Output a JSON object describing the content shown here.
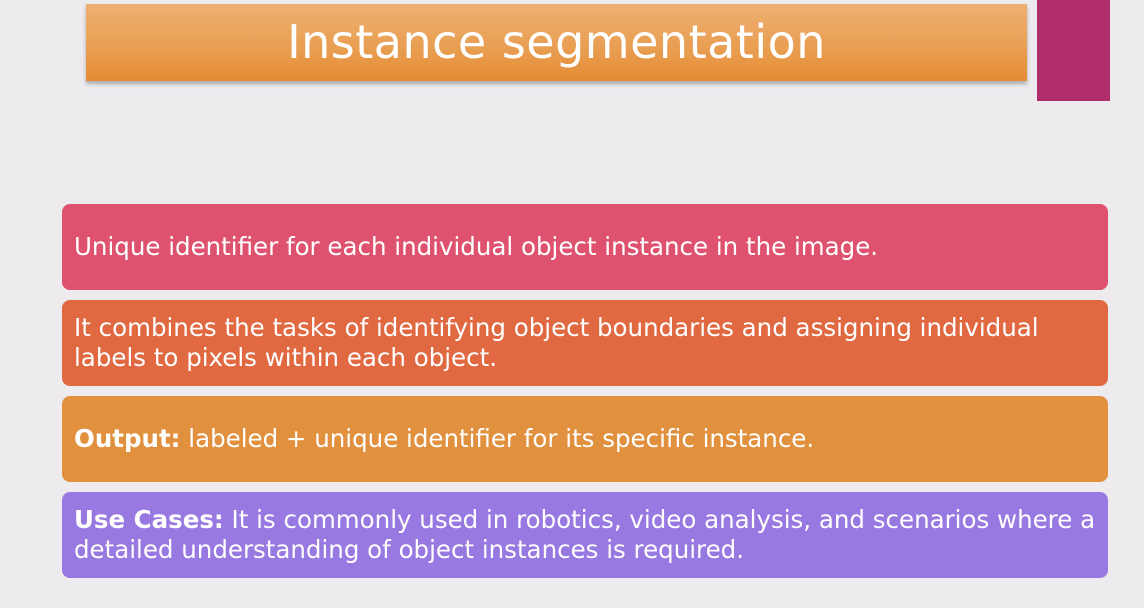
{
  "slide": {
    "title": "Instance segmentation",
    "items": [
      {
        "label": "",
        "text": "Unique identifier for each individual object instance in the image."
      },
      {
        "label": "",
        "text": "It combines the tasks of identifying object boundaries and assigning individual labels to pixels within each object."
      },
      {
        "label": "Output:",
        "text": " labeled + unique identifier for its specific instance."
      },
      {
        "label": "Use Cases:",
        "text": " It is commonly used in robotics, video analysis, and scenarios where a detailed understanding of object instances is required."
      }
    ]
  },
  "colors": {
    "background": "#edebee",
    "title_bar": "#e99f53",
    "accent_block": "#b02e6c",
    "box_1": "#df526f",
    "box_2": "#e06942",
    "box_3": "#e1903d",
    "box_4": "#9878e1"
  }
}
